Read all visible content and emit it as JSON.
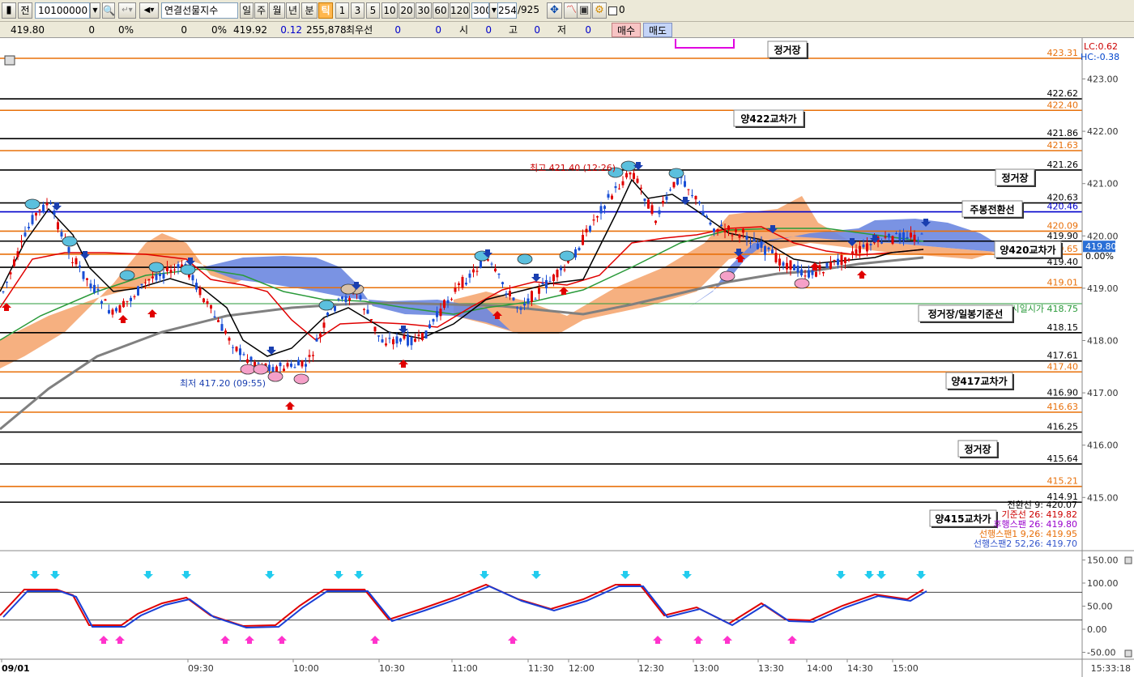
{
  "toolbar": {
    "code": "10100000",
    "jeon": "전",
    "name": "연결선물지수",
    "periods": [
      "일",
      "주",
      "월",
      "년",
      "분",
      "틱"
    ],
    "active_period": "틱",
    "intervals": [
      "1",
      "3",
      "5",
      "10",
      "20",
      "30",
      "60",
      "120"
    ],
    "interval_value": "300",
    "count": "254",
    "total": "/925",
    "checkbox_label": "0"
  },
  "quote": {
    "price": "419.80",
    "v1": "0",
    "p1": "0%",
    "v2": "0",
    "p2": "0%",
    "price2": "419.92",
    "change": "0.12",
    "volume": "255,878",
    "best_label": "최우선",
    "best_v1": "0",
    "best_v2": "0",
    "open_label": "시",
    "open_v": "0",
    "high_label": "고",
    "high_v": "0",
    "low_label": "저",
    "low_v": "0",
    "buy": "매수",
    "sell": "매도"
  },
  "corner": {
    "lc": "LC:0.62",
    "hc": "HC:-0.38"
  },
  "price_axis": [
    "423.00",
    "422.00",
    "421.00",
    "420.00",
    "419.00",
    "418.00",
    "417.00",
    "416.00",
    "415.00"
  ],
  "levels": [
    {
      "value": "423.31",
      "color": "#e8700a"
    },
    {
      "value": "422.62",
      "color": "#000000"
    },
    {
      "value": "422.40",
      "color": "#e8700a"
    },
    {
      "value": "421.86",
      "color": "#000000"
    },
    {
      "value": "421.63",
      "color": "#e8700a"
    },
    {
      "value": "421.26",
      "color": "#000000"
    },
    {
      "value": "420.63",
      "color": "#000000"
    },
    {
      "value": "420.46",
      "color": "#0000cc"
    },
    {
      "value": "420.09",
      "color": "#e8700a"
    },
    {
      "value": "419.90",
      "color": "#000000"
    },
    {
      "value": "419.65",
      "color": "#e8700a"
    },
    {
      "value": "419.40",
      "color": "#000000"
    },
    {
      "value": "419.01",
      "color": "#e8700a"
    },
    {
      "value": "418.15",
      "color": "#000000"
    },
    {
      "value": "417.61",
      "color": "#000000"
    },
    {
      "value": "417.40",
      "color": "#e8700a"
    },
    {
      "value": "416.90",
      "color": "#000000"
    },
    {
      "value": "416.63",
      "color": "#e8700a"
    },
    {
      "value": "416.25",
      "color": "#000000"
    },
    {
      "value": "415.64",
      "color": "#000000"
    },
    {
      "value": "415.21",
      "color": "#e8700a"
    },
    {
      "value": "414.91",
      "color": "#000000"
    }
  ],
  "current_price_tag": "419.80",
  "current_pct_tag": "0.00%",
  "open_price_label": "시일시가 418.75",
  "labels": {
    "top_session": "정거장",
    "l422": "양422교차가",
    "session_4212": "정거장",
    "weekly": "주봉전환선",
    "l420": "양420교차가",
    "session_daily": "정거장/일봉기준선",
    "l417": "양417교차가",
    "session_416": "정거장",
    "l415": "양415교차가"
  },
  "high_label": "최고 421.40 (12:26)",
  "low_label": "최저 417.20 (09:55)",
  "legend": [
    {
      "text": "전환선 9: 420.07",
      "color": "#000000"
    },
    {
      "text": "기준선 26: 419.82",
      "color": "#cc0000"
    },
    {
      "text": "후행스팬 26: 419.80",
      "color": "#9900cc"
    },
    {
      "text": "선행스팬1 9,26: 419.95",
      "color": "#e8700a"
    },
    {
      "text": "선행스팬2 52,26: 419.70",
      "color": "#3355cc"
    }
  ],
  "osc_axis": [
    "150.00",
    "100.00",
    "50.00",
    "0.00",
    "-50.00"
  ],
  "time_axis": [
    "09/01",
    "09:30",
    "10:00",
    "10:30",
    "11:00",
    "11:30",
    "12:00",
    "12:30",
    "13:00",
    "13:30",
    "14:00",
    "14:30",
    "15:00"
  ],
  "clock": "15:33:18"
}
